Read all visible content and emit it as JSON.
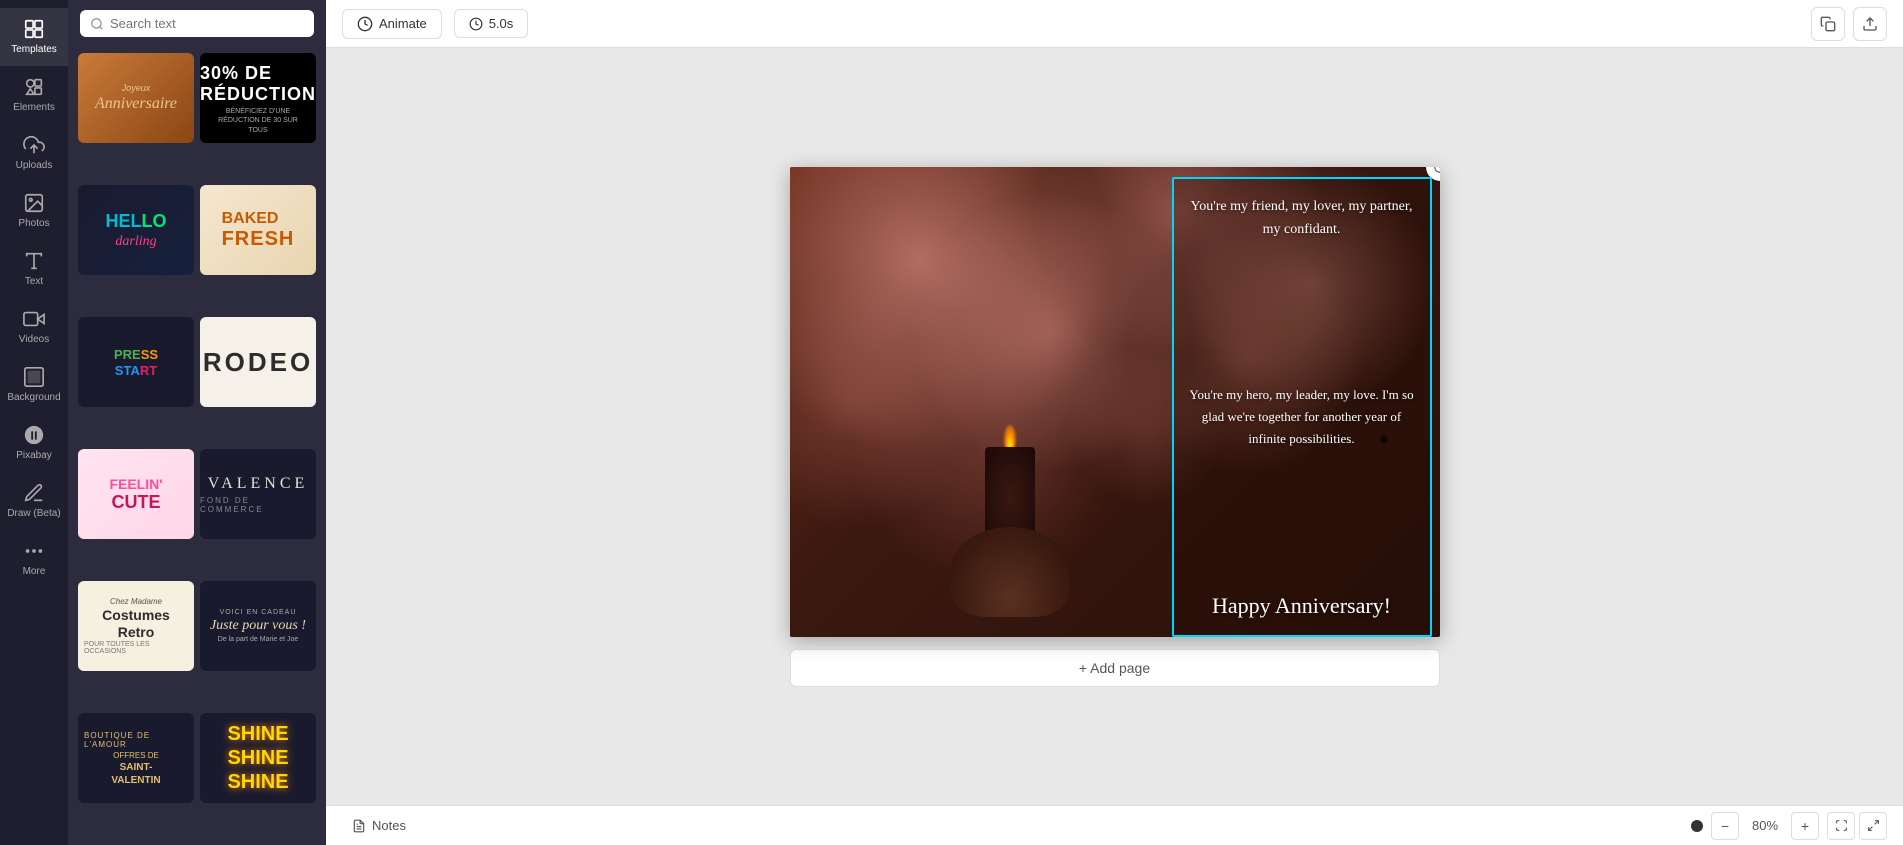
{
  "sidebar": {
    "items": [
      {
        "id": "templates",
        "label": "Templates",
        "icon": "grid"
      },
      {
        "id": "elements",
        "label": "Elements",
        "icon": "shapes"
      },
      {
        "id": "uploads",
        "label": "Uploads",
        "icon": "upload"
      },
      {
        "id": "photos",
        "label": "Photos",
        "icon": "image"
      },
      {
        "id": "text",
        "label": "Text",
        "icon": "text"
      },
      {
        "id": "videos",
        "label": "Videos",
        "icon": "video"
      },
      {
        "id": "background",
        "label": "Background",
        "icon": "background"
      },
      {
        "id": "pixabay",
        "label": "Pixabay",
        "icon": "pixabay"
      },
      {
        "id": "draw",
        "label": "Draw (Beta)",
        "icon": "draw"
      },
      {
        "id": "more",
        "label": "More",
        "icon": "more"
      }
    ],
    "active": "text"
  },
  "search": {
    "placeholder": "Search text"
  },
  "templates": [
    {
      "id": 1,
      "type": "anniversaire",
      "label": "Joyeux Anniversaire"
    },
    {
      "id": 2,
      "type": "reduction",
      "label": "30 DE RÉDUCTION"
    },
    {
      "id": 3,
      "type": "hello",
      "label": "Hello Darling"
    },
    {
      "id": 4,
      "type": "baked",
      "label": "Baked Fresh"
    },
    {
      "id": 5,
      "type": "press",
      "label": "Press Start"
    },
    {
      "id": 6,
      "type": "rodeo",
      "label": "Rodeo"
    },
    {
      "id": 7,
      "type": "feelin",
      "label": "Feelin Cute"
    },
    {
      "id": 8,
      "type": "valence",
      "label": "Valence"
    },
    {
      "id": 9,
      "type": "costumes",
      "label": "Costumes Retro"
    },
    {
      "id": 10,
      "type": "juste",
      "label": "Juste pour vous"
    },
    {
      "id": 11,
      "type": "saint",
      "label": "Offres de Saint-Valentin"
    },
    {
      "id": 12,
      "type": "shine",
      "label": "Shine Shine Shine"
    }
  ],
  "topbar": {
    "animate_label": "Animate",
    "duration": "5.0s",
    "copy_icon": "copy",
    "export_icon": "export"
  },
  "canvas": {
    "verse1": "You're my friend, my lover, my partner, my confidant.",
    "verse2": "You're my hero, my leader, my love. I'm so glad we're together for another year of infinite possibilities.",
    "signature": "Happy Anniversary!"
  },
  "add_page_label": "+ Add page",
  "bottombar": {
    "notes_label": "Notes",
    "zoom_percent": "80%",
    "zoom_in_label": "+",
    "zoom_out_label": "−"
  }
}
